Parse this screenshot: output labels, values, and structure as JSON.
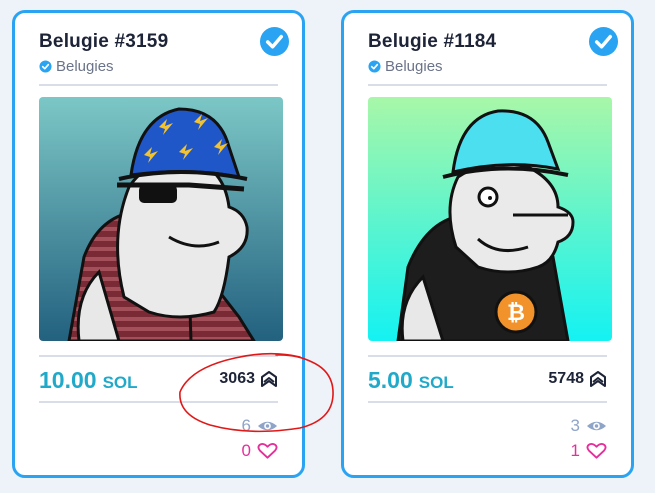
{
  "cards": [
    {
      "title": "Belugie #3159",
      "collection": "Belugies",
      "price": "10.00",
      "currency": "SOL",
      "rank": "3063",
      "views": "6",
      "likes": "0",
      "icons": [
        "verified-check-icon",
        "rank-icon",
        "eye-icon",
        "heart-icon"
      ]
    },
    {
      "title": "Belugie #1184",
      "collection": "Belugies",
      "price": "5.00",
      "currency": "SOL",
      "rank": "5748",
      "views": "3",
      "likes": "1",
      "icons": [
        "verified-check-icon",
        "rank-icon",
        "eye-icon",
        "heart-icon"
      ]
    }
  ],
  "colors": {
    "border": "#2aa4f2",
    "price": "#21a9c9",
    "likes": "#e52f9b",
    "views": "#8fa4c9",
    "annotation": "#e01818"
  }
}
